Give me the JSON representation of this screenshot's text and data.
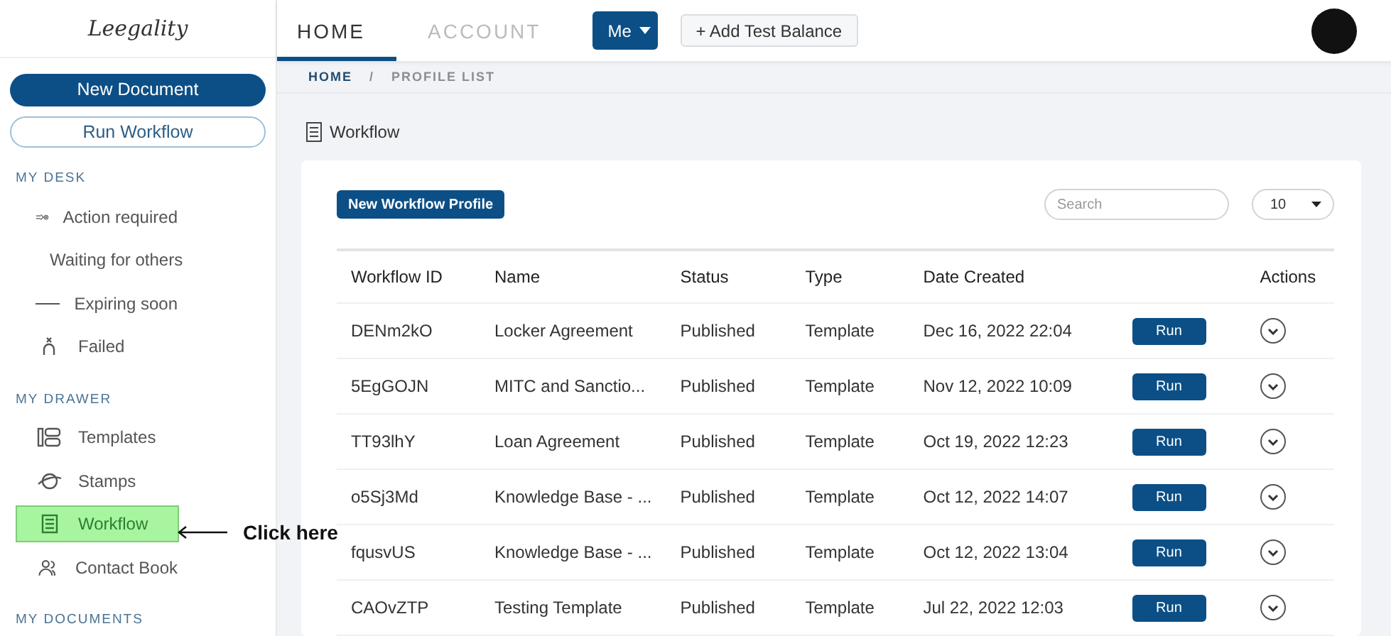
{
  "logo": {
    "text": "Leegality"
  },
  "sidebar": {
    "primary_button": "New Document",
    "secondary_button": "Run Workflow",
    "sections": [
      {
        "title": "MY DESK",
        "items": [
          {
            "label": "Action required",
            "selected": false
          },
          {
            "label": "Waiting for others",
            "selected": false
          },
          {
            "label": "Expiring soon",
            "selected": false
          },
          {
            "label": "Failed",
            "selected": false
          }
        ]
      },
      {
        "title": "MY DRAWER",
        "items": [
          {
            "label": "Templates",
            "selected": false
          },
          {
            "label": "Stamps",
            "selected": false
          },
          {
            "label": "Workflow",
            "selected": true
          },
          {
            "label": "Contact Book",
            "selected": false
          }
        ]
      },
      {
        "title": "MY DOCUMENTS"
      }
    ]
  },
  "annotation": {
    "text": "Click here"
  },
  "topbar": {
    "tabs": [
      {
        "label": "HOME",
        "selected": true
      },
      {
        "label": "ACCOUNT",
        "selected": false
      }
    ],
    "user_menu": "Me",
    "add_balance_button": "+ Add Test Balance"
  },
  "breadcrumb": [
    "HOME",
    "PROFILE LIST"
  ],
  "breadcrumb_separator": "/",
  "page_title": "Workflow",
  "toolbar": {
    "new_button": "New Workflow Profile",
    "search": {
      "placeholder": "Search"
    },
    "page_size": "10"
  },
  "table": {
    "columns": [
      "Workflow ID",
      "Name",
      "Status",
      "Type",
      "Date Created",
      "",
      "Actions"
    ],
    "rows": [
      {
        "id": "DENm2kO",
        "name": "Locker Agreement",
        "status": "Published",
        "type": "Template",
        "date": "Dec 16, 2022 22:04",
        "run": "Run"
      },
      {
        "id": "5EgGOJN",
        "name": "MITC and Sanctio...",
        "status": "Published",
        "type": "Template",
        "date": "Nov 12, 2022 10:09",
        "run": "Run"
      },
      {
        "id": "TT93lhY",
        "name": "Loan Agreement",
        "status": "Published",
        "type": "Template",
        "date": "Oct 19, 2022 12:23",
        "run": "Run"
      },
      {
        "id": "o5Sj3Md",
        "name": "Knowledge Base - ...",
        "status": "Published",
        "type": "Template",
        "date": "Oct 12, 2022 14:07",
        "run": "Run"
      },
      {
        "id": "fqusvUS",
        "name": "Knowledge Base - ...",
        "status": "Published",
        "type": "Template",
        "date": "Oct 12, 2022 13:04",
        "run": "Run"
      },
      {
        "id": "CAOvZTP",
        "name": "Testing Template",
        "status": "Published",
        "type": "Template",
        "date": "Jul 22, 2022 12:03",
        "run": "Run"
      }
    ]
  }
}
